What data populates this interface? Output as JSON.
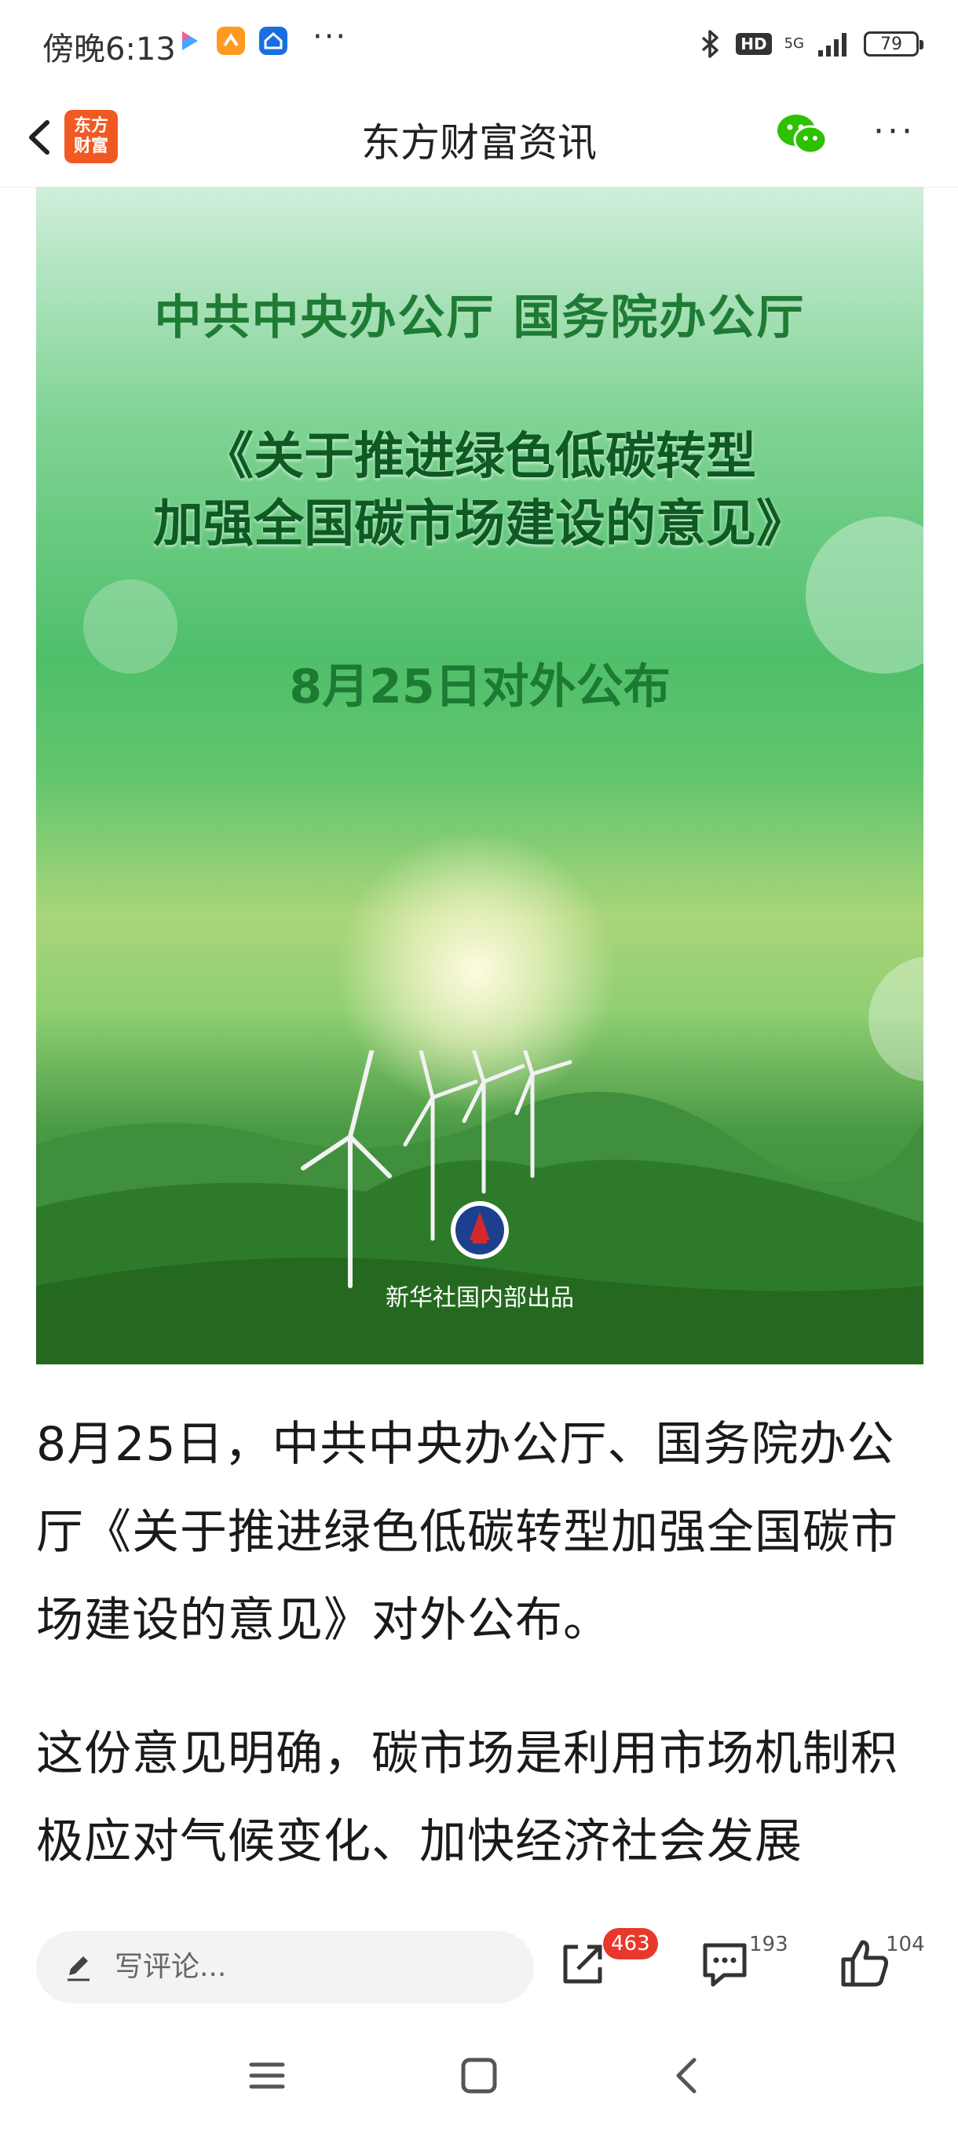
{
  "status_bar": {
    "time": "傍晚6:13",
    "more": "···",
    "hd": "HD",
    "network": "5G",
    "battery": "79"
  },
  "header": {
    "logo_text": "东方\n财富",
    "title": "东方财富资讯",
    "more": "···"
  },
  "poster": {
    "line1": "中共中央办公厅 国务院办公厅",
    "line2": "《关于推进绿色低碳转型",
    "line3": "加强全国碳市场建设的意见》",
    "line4": "8月25日对外公布",
    "credit": "新华社国内部出品"
  },
  "article": {
    "paragraph1": "8月25日，中共中央办公厅、国务院办公厅《关于推进绿色低碳转型加强全国碳市场建设的意见》对外公布。",
    "paragraph2": "这份意见明确，碳市场是利用市场机制积极应对气候变化、加快经济社会发展"
  },
  "action_bar": {
    "comment_placeholder": "写评论...",
    "share_badge": "463",
    "comment_count": "193",
    "like_count": "104"
  },
  "colors": {
    "brand": "#f05a22",
    "badge": "#e8382c",
    "wechat": "#2dc100"
  }
}
